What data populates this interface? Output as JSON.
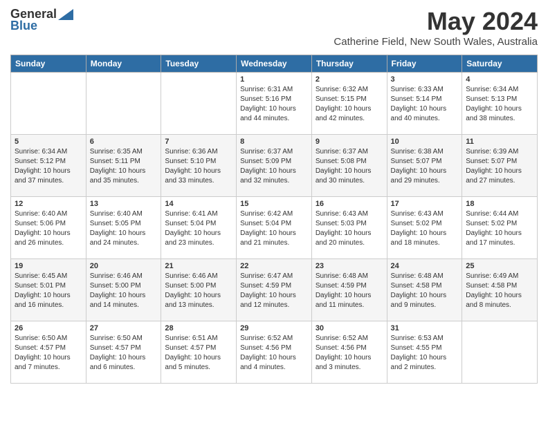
{
  "logo": {
    "general": "General",
    "blue": "Blue"
  },
  "title": "May 2024",
  "subtitle": "Catherine Field, New South Wales, Australia",
  "days_of_week": [
    "Sunday",
    "Monday",
    "Tuesday",
    "Wednesday",
    "Thursday",
    "Friday",
    "Saturday"
  ],
  "weeks": [
    [
      {
        "day": "",
        "info": ""
      },
      {
        "day": "",
        "info": ""
      },
      {
        "day": "",
        "info": ""
      },
      {
        "day": "1",
        "info": "Sunrise: 6:31 AM\nSunset: 5:16 PM\nDaylight: 10 hours\nand 44 minutes."
      },
      {
        "day": "2",
        "info": "Sunrise: 6:32 AM\nSunset: 5:15 PM\nDaylight: 10 hours\nand 42 minutes."
      },
      {
        "day": "3",
        "info": "Sunrise: 6:33 AM\nSunset: 5:14 PM\nDaylight: 10 hours\nand 40 minutes."
      },
      {
        "day": "4",
        "info": "Sunrise: 6:34 AM\nSunset: 5:13 PM\nDaylight: 10 hours\nand 38 minutes."
      }
    ],
    [
      {
        "day": "5",
        "info": "Sunrise: 6:34 AM\nSunset: 5:12 PM\nDaylight: 10 hours\nand 37 minutes."
      },
      {
        "day": "6",
        "info": "Sunrise: 6:35 AM\nSunset: 5:11 PM\nDaylight: 10 hours\nand 35 minutes."
      },
      {
        "day": "7",
        "info": "Sunrise: 6:36 AM\nSunset: 5:10 PM\nDaylight: 10 hours\nand 33 minutes."
      },
      {
        "day": "8",
        "info": "Sunrise: 6:37 AM\nSunset: 5:09 PM\nDaylight: 10 hours\nand 32 minutes."
      },
      {
        "day": "9",
        "info": "Sunrise: 6:37 AM\nSunset: 5:08 PM\nDaylight: 10 hours\nand 30 minutes."
      },
      {
        "day": "10",
        "info": "Sunrise: 6:38 AM\nSunset: 5:07 PM\nDaylight: 10 hours\nand 29 minutes."
      },
      {
        "day": "11",
        "info": "Sunrise: 6:39 AM\nSunset: 5:07 PM\nDaylight: 10 hours\nand 27 minutes."
      }
    ],
    [
      {
        "day": "12",
        "info": "Sunrise: 6:40 AM\nSunset: 5:06 PM\nDaylight: 10 hours\nand 26 minutes."
      },
      {
        "day": "13",
        "info": "Sunrise: 6:40 AM\nSunset: 5:05 PM\nDaylight: 10 hours\nand 24 minutes."
      },
      {
        "day": "14",
        "info": "Sunrise: 6:41 AM\nSunset: 5:04 PM\nDaylight: 10 hours\nand 23 minutes."
      },
      {
        "day": "15",
        "info": "Sunrise: 6:42 AM\nSunset: 5:04 PM\nDaylight: 10 hours\nand 21 minutes."
      },
      {
        "day": "16",
        "info": "Sunrise: 6:43 AM\nSunset: 5:03 PM\nDaylight: 10 hours\nand 20 minutes."
      },
      {
        "day": "17",
        "info": "Sunrise: 6:43 AM\nSunset: 5:02 PM\nDaylight: 10 hours\nand 18 minutes."
      },
      {
        "day": "18",
        "info": "Sunrise: 6:44 AM\nSunset: 5:02 PM\nDaylight: 10 hours\nand 17 minutes."
      }
    ],
    [
      {
        "day": "19",
        "info": "Sunrise: 6:45 AM\nSunset: 5:01 PM\nDaylight: 10 hours\nand 16 minutes."
      },
      {
        "day": "20",
        "info": "Sunrise: 6:46 AM\nSunset: 5:00 PM\nDaylight: 10 hours\nand 14 minutes."
      },
      {
        "day": "21",
        "info": "Sunrise: 6:46 AM\nSunset: 5:00 PM\nDaylight: 10 hours\nand 13 minutes."
      },
      {
        "day": "22",
        "info": "Sunrise: 6:47 AM\nSunset: 4:59 PM\nDaylight: 10 hours\nand 12 minutes."
      },
      {
        "day": "23",
        "info": "Sunrise: 6:48 AM\nSunset: 4:59 PM\nDaylight: 10 hours\nand 11 minutes."
      },
      {
        "day": "24",
        "info": "Sunrise: 6:48 AM\nSunset: 4:58 PM\nDaylight: 10 hours\nand 9 minutes."
      },
      {
        "day": "25",
        "info": "Sunrise: 6:49 AM\nSunset: 4:58 PM\nDaylight: 10 hours\nand 8 minutes."
      }
    ],
    [
      {
        "day": "26",
        "info": "Sunrise: 6:50 AM\nSunset: 4:57 PM\nDaylight: 10 hours\nand 7 minutes."
      },
      {
        "day": "27",
        "info": "Sunrise: 6:50 AM\nSunset: 4:57 PM\nDaylight: 10 hours\nand 6 minutes."
      },
      {
        "day": "28",
        "info": "Sunrise: 6:51 AM\nSunset: 4:57 PM\nDaylight: 10 hours\nand 5 minutes."
      },
      {
        "day": "29",
        "info": "Sunrise: 6:52 AM\nSunset: 4:56 PM\nDaylight: 10 hours\nand 4 minutes."
      },
      {
        "day": "30",
        "info": "Sunrise: 6:52 AM\nSunset: 4:56 PM\nDaylight: 10 hours\nand 3 minutes."
      },
      {
        "day": "31",
        "info": "Sunrise: 6:53 AM\nSunset: 4:55 PM\nDaylight: 10 hours\nand 2 minutes."
      },
      {
        "day": "",
        "info": ""
      }
    ]
  ]
}
